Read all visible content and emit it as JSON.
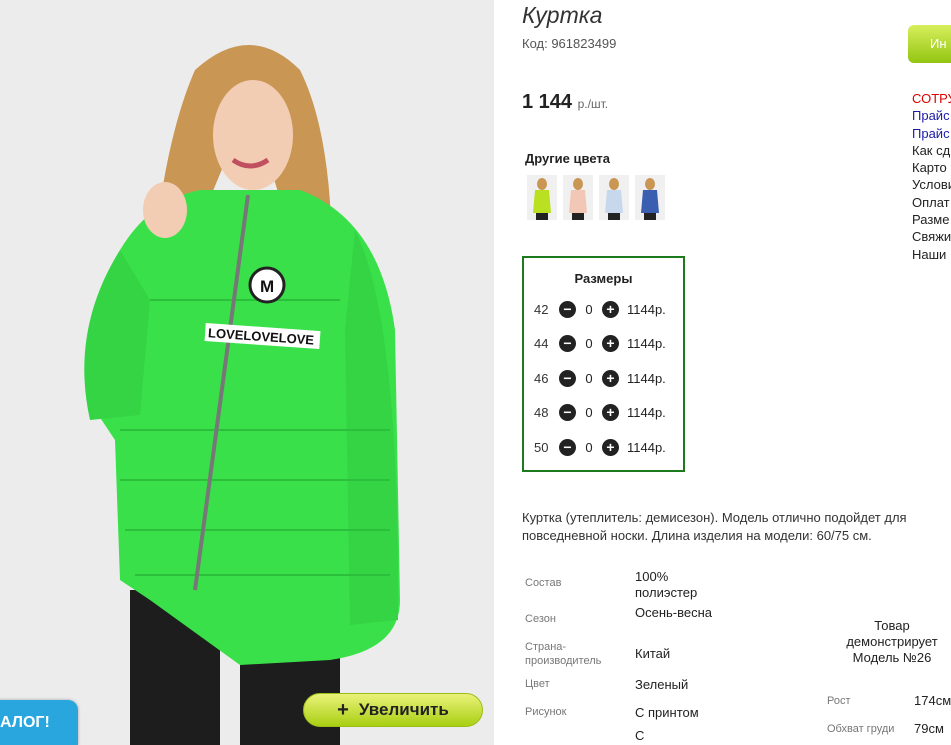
{
  "product": {
    "title": "Куртка",
    "code": "Код: 961823499",
    "price_value": "1 144",
    "price_unit": "р./шт.",
    "other_colors_title": "Другие цвета",
    "other_colors": [
      {
        "icon": "jacket-thumb-lime",
        "color": "#b9e021"
      },
      {
        "icon": "jacket-thumb-peach",
        "color": "#f3c7b5"
      },
      {
        "icon": "jacket-thumb-lightblue",
        "color": "#c8d8ec"
      },
      {
        "icon": "jacket-thumb-blue",
        "color": "#3a5fb0"
      }
    ],
    "image_color": "#39e04a",
    "zoom_label": "Увеличить",
    "zoom_plus": "+",
    "catalog_tab": "АЛОГ!",
    "jacket_print": "LOVELOVELOVE",
    "jacket_badge": "M"
  },
  "sizes": {
    "title": "Размеры",
    "rows": [
      {
        "size": "42",
        "qty": "0",
        "price": "1144р."
      },
      {
        "size": "44",
        "qty": "0",
        "price": "1144р."
      },
      {
        "size": "46",
        "qty": "0",
        "price": "1144р."
      },
      {
        "size": "48",
        "qty": "0",
        "price": "1144р."
      },
      {
        "size": "50",
        "qty": "0",
        "price": "1144р."
      }
    ],
    "minus_symbol": "−",
    "plus_symbol": "+"
  },
  "description": "Куртка (утеплитель: демисезон). Модель отлично подойдет для повседневной носки. Длина изделия на модели: 60/75 см.",
  "specs": [
    {
      "label": "Состав",
      "value": "100% полиэстер"
    },
    {
      "label": "Сезон",
      "value": "Осень-весна"
    },
    {
      "label": "Страна-производитель",
      "value": "Китай"
    },
    {
      "label": "Цвет",
      "value": "Зеленый"
    },
    {
      "label": "Рисунок",
      "value": "С принтом"
    },
    {
      "label": "",
      "value": "С"
    }
  ],
  "model": {
    "caption": "Товар демонстрирует Модель №26",
    "measures": [
      {
        "label": "Рост",
        "value": "174см"
      },
      {
        "label": "Обхват груди",
        "value": "79см"
      }
    ]
  },
  "right_panel": {
    "button_label": "Ин",
    "links": [
      {
        "text": "СОТРУ",
        "style": "red"
      },
      {
        "text": "Прайс",
        "style": "blue"
      },
      {
        "text": "Прайс",
        "style": "blue"
      },
      {
        "text": "Как сд",
        "style": "dark"
      },
      {
        "text": "Карто",
        "style": "dark"
      },
      {
        "text": "Услови",
        "style": "dark"
      },
      {
        "text": "Оплат",
        "style": "dark"
      },
      {
        "text": "Разме",
        "style": "dark"
      },
      {
        "text": "Свяжи",
        "style": "dark"
      },
      {
        "text": "Наши",
        "style": "dark"
      }
    ]
  }
}
